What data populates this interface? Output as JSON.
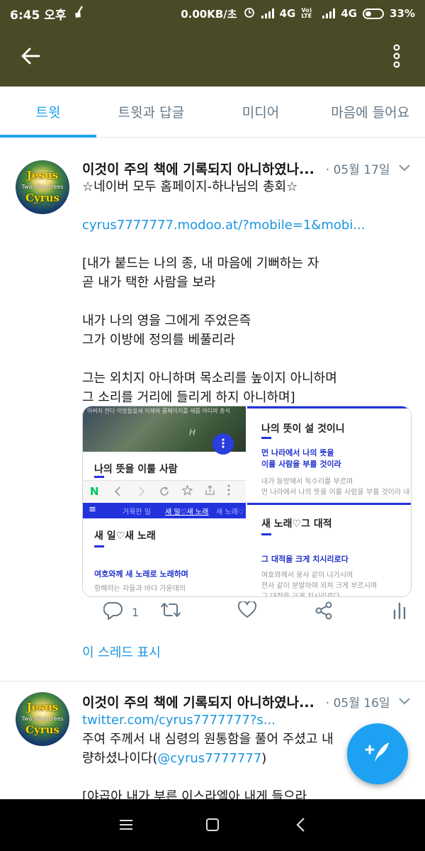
{
  "status_bar": {
    "time": "6:45 오후",
    "net_speed": "0.00KB/초",
    "net1": "4G",
    "volte": "Vo) LTE",
    "net2": "4G",
    "battery": "33%"
  },
  "tabs": [
    {
      "label": "트윗",
      "active": true
    },
    {
      "label": "트윗과 답글",
      "active": false
    },
    {
      "label": "미디어",
      "active": false
    },
    {
      "label": "마음에 들어요",
      "active": false
    }
  ],
  "tweets": [
    {
      "title": "이것이 주의 책에 기록되지 아니하였나...",
      "date": "· 05월 17일",
      "avatar": {
        "top": "Jesus",
        "mid": "Two olive trees",
        "bottom": "Cyrus"
      },
      "lines": [
        "☆네이버 모두 홈페이지-하나님의 총회☆",
        "",
        "cyrus7777777.modoo.at/?mobile=1&mobi...",
        "",
        "[내가 붙드는 나의 종, 내 마음에 기뻐하는 자",
        "곧 내가 택한 사람을 보라",
        "",
        "내가 나의 영을 그에게 주었은즉",
        "그가 이방에 정의를 베풀리라",
        "",
        "그는 외치지 아니하며 목소리를 높이지 아니하며",
        "그 소리를 거리에 들리게 하지 아니하며]"
      ],
      "media": {
        "tl_title": "나의 뜻을 이룰 사람",
        "tl_banner": "아버지 한다 이방들을세 이제와 롬페이지를 세롭 아디의 총석",
        "tl_icon_letter": "H",
        "tl_nav": "N",
        "bl_tabs": [
          "≡",
          "거룩한 일",
          "새 일♡새 노래",
          "새 노래♡"
        ],
        "bl_title": "새 일♡새 노래",
        "bl_blue": "여호와께 새 노래로 노래하며",
        "bl_gray": "항해하는 자들과 바다 가운데의",
        "tr_title": "나의 뜻이 설 것이니",
        "tr_blue1": "먼 나라에서 나의 뜻을",
        "tr_blue2": "이룰 사람을 부를 것이라",
        "tr_gray1": "내가 동방에서 독수리를 부르며",
        "tr_gray2": "먼 나라에서 나의 뜻을 이룰 사람을 부를 것이라 내",
        "br_title": "새 노래♡그 대적",
        "br_blue": "그 대적을 크게 치시리로다",
        "br_gray1": "여호와께서 용사 같이 나가시며",
        "br_gray2": "전사 같이 분발하여 외쳐 크게 부르시며",
        "br_gray3": "그 대적을 크게 치시리로다"
      },
      "actions": {
        "reply_count": "1",
        "retweet_count": "",
        "like_count": ""
      },
      "show_thread": "이 스레드 표시"
    },
    {
      "title": "이것이 주의 책에 기록되지 아니하였나...",
      "date": "· 05월 16일",
      "avatar": {
        "top": "Jesus",
        "mid": "Two olive trees",
        "bottom": "Cyrus"
      },
      "lines": [
        "twitter.com/cyrus7777777?s...",
        "주여 주께서 내 심령의 원통함을 풀어 주셨고 내",
        "량하셨나이다(@cyrus7777777)",
        "",
        "[야곱아 내가 부른 이스라엘아 내게 들으라"
      ]
    }
  ],
  "icons": {
    "back": "arrow-left-icon",
    "more": "more-vertical-icon",
    "compose": "compose-tweet-icon"
  },
  "colors": {
    "accent": "#1da1f2",
    "link": "#1b95e0",
    "appbar": "#4a4a26"
  }
}
